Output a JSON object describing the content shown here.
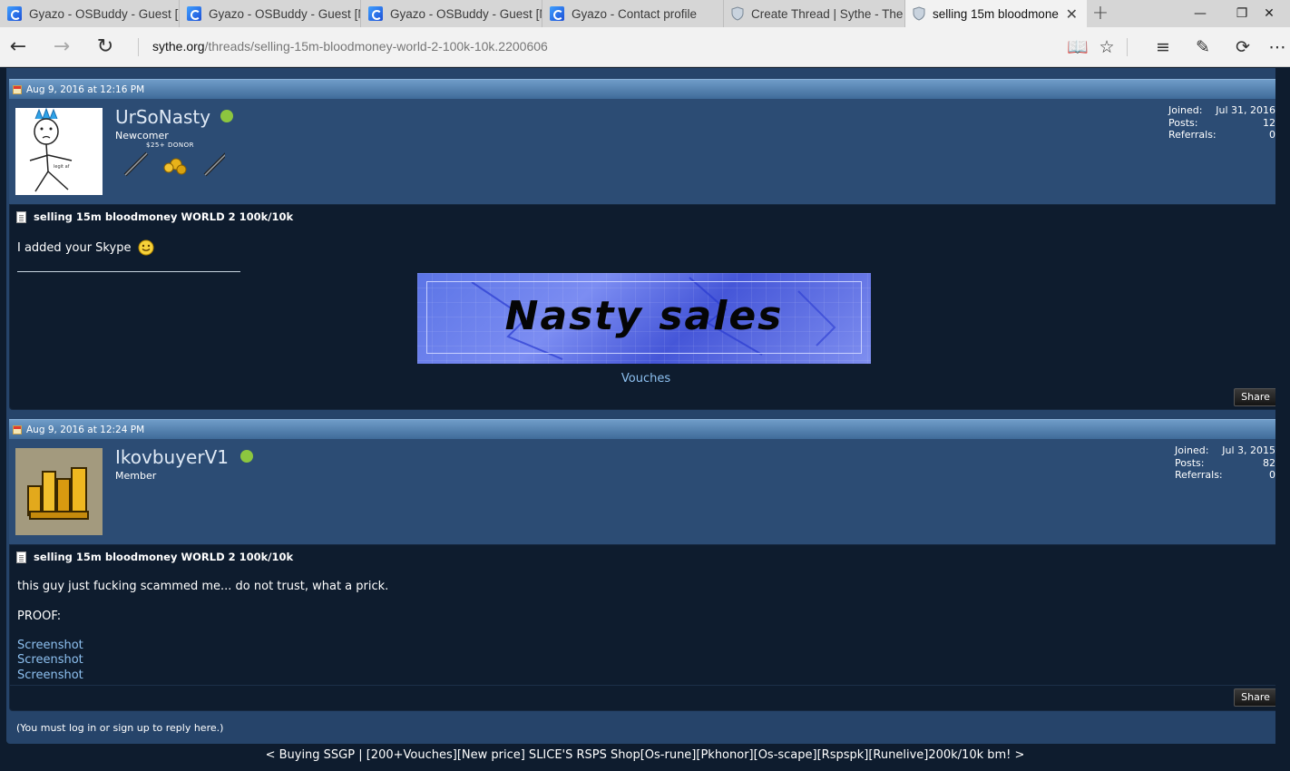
{
  "browser": {
    "tabs": [
      {
        "title": "Gyazo - OSBuddy - Guest [M",
        "icon": "gyazo-icon"
      },
      {
        "title": "Gyazo - OSBuddy - Guest [M",
        "icon": "gyazo-icon"
      },
      {
        "title": "Gyazo - OSBuddy - Guest [M",
        "icon": "gyazo-icon"
      },
      {
        "title": "Gyazo - Contact profile",
        "icon": "gyazo-icon"
      },
      {
        "title": "Create Thread | Sythe - The",
        "icon": "shield-icon"
      },
      {
        "title": "selling 15m bloodmone",
        "icon": "shield-icon"
      }
    ],
    "new_tab": "+",
    "url_host": "sythe.org",
    "url_path": "/threads/selling-15m-bloodmoney-world-2-100k-10k.2200606"
  },
  "posts": [
    {
      "date": "Aug 9, 2016 at 12:16 PM",
      "username": "UrSoNasty",
      "rank": "Newcomer",
      "badge_text": "$25+ DONOR",
      "joined_label": "Joined:",
      "joined": "Jul 31, 2016",
      "posts_label": "Posts:",
      "posts": "12",
      "referrals_label": "Referrals:",
      "referrals": "0",
      "title": "selling 15m bloodmoney WORLD 2 100k/10k",
      "message": "I added your Skype",
      "banner_text": "Nasty sales",
      "vouches_link": "Vouches",
      "share": "Share"
    },
    {
      "date": "Aug 9, 2016 at 12:24 PM",
      "username": "IkovbuyerV1",
      "rank": "Member",
      "joined_label": "Joined:",
      "joined": "Jul 3, 2015",
      "posts_label": "Posts:",
      "posts": "82",
      "referrals_label": "Referrals:",
      "referrals": "0",
      "title": "selling 15m bloodmoney WORLD 2 100k/10k",
      "message": "this guy just fucking scammed me... do not trust, what a prick.",
      "proof_label": "PROOF:",
      "links": [
        "Screenshot",
        "Screenshot",
        "Screenshot"
      ],
      "share": "Share"
    }
  ],
  "reply_note": "(You must log in or sign up to reply here.)",
  "thread_nav": "< Buying SSGP | [200+Vouches][New price] SLICE'S RSPS Shop[Os-rune][Pkhonor][Os-scape][Rspspk][Runelive]200k/10k bm! >",
  "colors": {
    "page_bg": "#0e1c2e",
    "userblock_bg": "#2c4c74",
    "header_bar": "#4f7fb0",
    "online": "#8cc63f",
    "link": "#8dc0f0"
  }
}
